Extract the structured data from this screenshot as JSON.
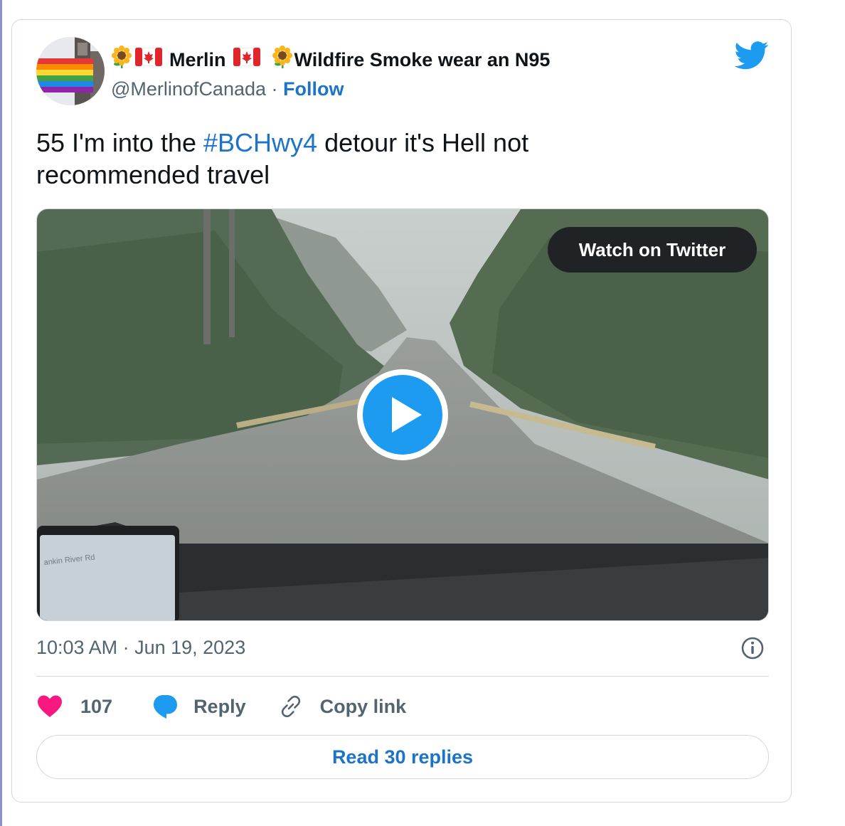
{
  "author": {
    "display_name_left": "Merlin",
    "display_name_right": "Wildfire Smoke wear an N95",
    "handle": "@MerlinofCanada",
    "separator": " · ",
    "follow_label": "Follow"
  },
  "tweet": {
    "text_before": "55 I'm into the ",
    "hashtag": "#BCHwy4",
    "text_after": " detour it's Hell not recommended travel"
  },
  "media": {
    "watch_label": "Watch on Twitter",
    "gps_street": "ankin River Rd"
  },
  "meta": {
    "timestamp": "10:03 AM · Jun 19, 2023"
  },
  "actions": {
    "like_count": "107",
    "reply_label": "Reply",
    "copy_label": "Copy link"
  },
  "read_replies_label": "Read 30 replies",
  "colors": {
    "link": "#1d74c6",
    "heart": "#f91880",
    "reply_bubble": "#1d9bf0",
    "play": "#1d9bf0",
    "twitter_blue": "#1d9bf0"
  },
  "icons": [
    "sunflower-icon",
    "canada-flag-icon",
    "twitter-logo-icon",
    "play-icon",
    "info-icon",
    "heart-icon",
    "reply-icon",
    "link-icon"
  ]
}
